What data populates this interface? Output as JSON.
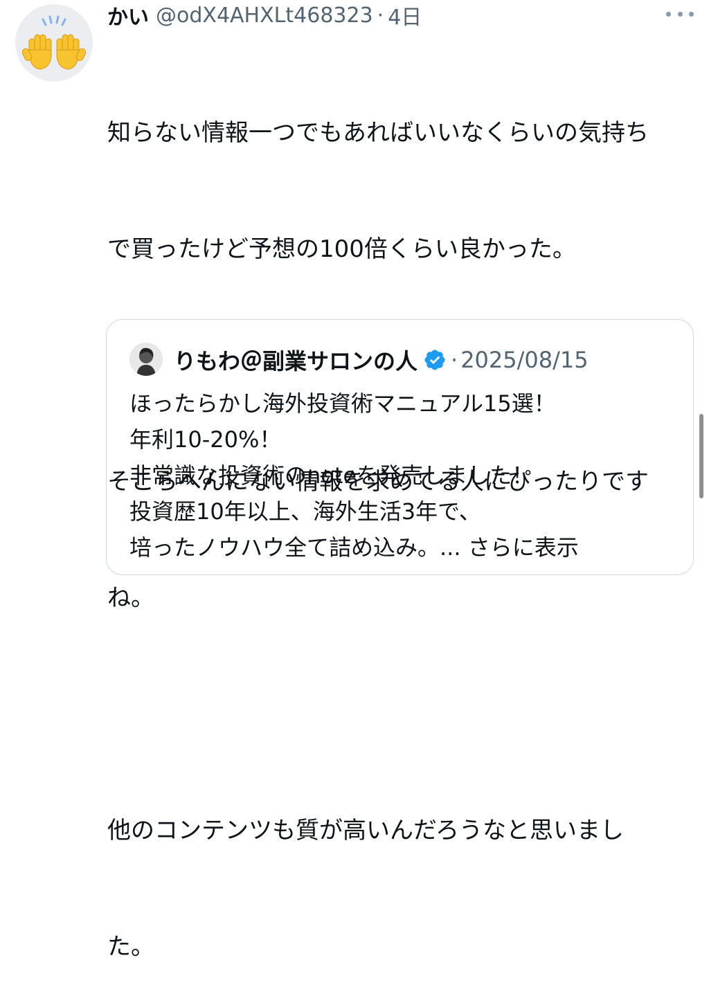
{
  "tweet": {
    "author_name": "かい",
    "handle": "@odX4AHXLt468323",
    "separator": "·",
    "time": "4日",
    "avatar_emoji": "🙌",
    "avatar_icon": "raising-hands-emoji",
    "more_icon": "more-horizontal-icon",
    "body_lines": [
      "知らない情報一つでもあればいいなくらいの気持ち",
      "で買ったけど予想の100倍くらい良かった。",
      "",
      "そこらへんにない情報を求めてる人にぴったりです",
      "ね。",
      "",
      "他のコンテンツも質が高いんだろうなと思いまし",
      "た。"
    ]
  },
  "quote": {
    "author_name": "りもわ＠副業サロンの人",
    "verified_icon": "verified-badge-icon",
    "verified_color": "#1d9bf0",
    "separator": "·",
    "date": "2025/08/15",
    "body_lines": [
      "ほったらかし海外投資術マニュアル15選！",
      "年利10-20%！",
      "非常識な投資術のnoteを発売しました！",
      "投資歴10年以上、海外生活3年で、"
    ],
    "last_line": "培ったノウハウ全て詰め込み。...",
    "show_more": "さらに表示"
  },
  "colors": {
    "text": "#0f1419",
    "secondary": "#536471",
    "border": "#cfd9de"
  }
}
